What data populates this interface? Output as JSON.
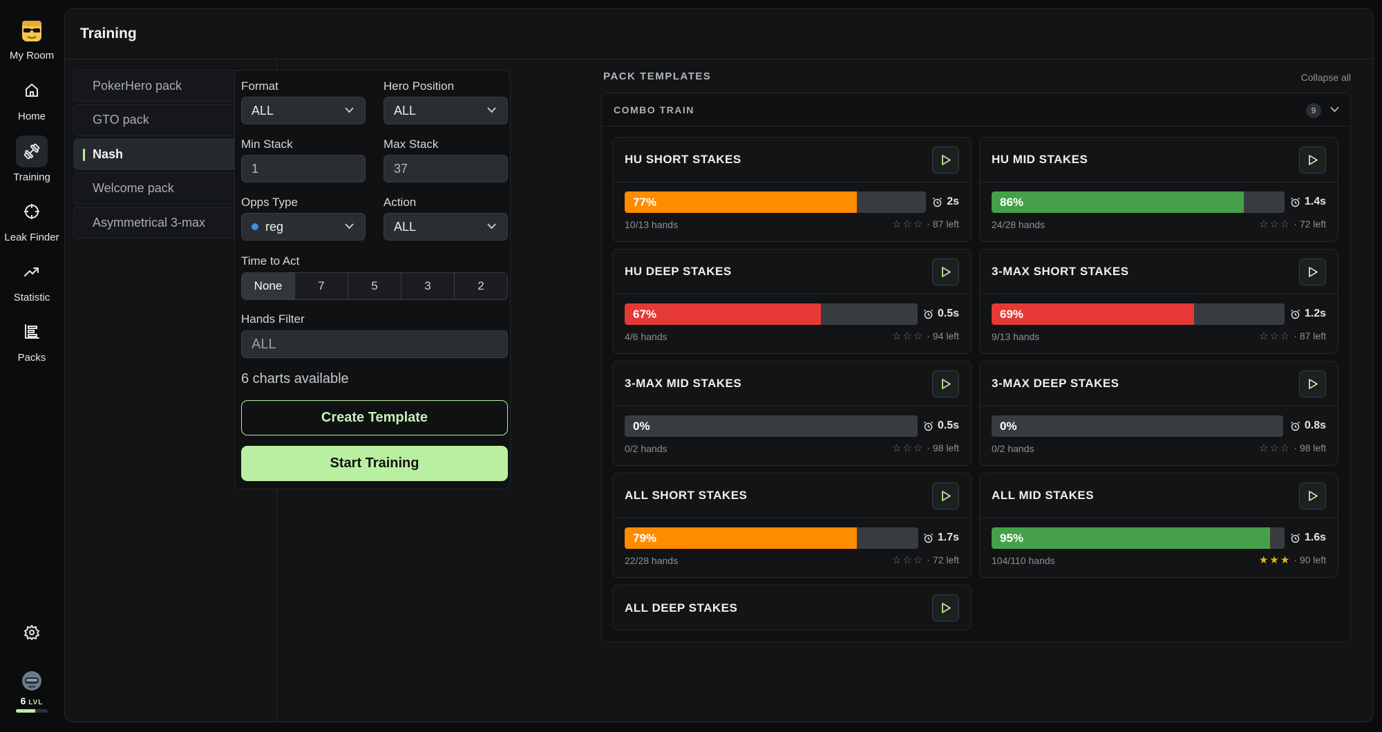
{
  "sidebar": {
    "items": [
      {
        "label": "My Room",
        "icon": "sunglasses-avatar-icon"
      },
      {
        "label": "Home",
        "icon": "home-icon"
      },
      {
        "label": "Training",
        "icon": "dumbbell-icon"
      },
      {
        "label": "Leak Finder",
        "icon": "crosshair-icon"
      },
      {
        "label": "Statistic",
        "icon": "trend-icon"
      },
      {
        "label": "Packs",
        "icon": "packs-icon"
      }
    ],
    "settings_icon": "gear-icon",
    "level": {
      "number": "6",
      "suffix": "LVL",
      "progress": 0.6
    }
  },
  "header": {
    "title": "Training"
  },
  "packs": [
    {
      "label": "PokerHero pack",
      "active": false
    },
    {
      "label": "GTO pack",
      "active": false
    },
    {
      "label": "Nash",
      "active": true
    },
    {
      "label": "Welcome pack",
      "active": false
    },
    {
      "label": "Asymmetrical 3-max",
      "active": false
    }
  ],
  "filters": {
    "format": {
      "label": "Format",
      "value": "ALL"
    },
    "hero_position": {
      "label": "Hero Position",
      "value": "ALL"
    },
    "min_stack": {
      "label": "Min Stack",
      "value": "1"
    },
    "max_stack": {
      "label": "Max Stack",
      "value": "37"
    },
    "opps_type": {
      "label": "Opps Type",
      "value": "reg"
    },
    "action": {
      "label": "Action",
      "value": "ALL"
    },
    "time_to_act": {
      "label": "Time to Act",
      "options": [
        "None",
        "7",
        "5",
        "3",
        "2"
      ],
      "selected": "None"
    },
    "hands_filter": {
      "label": "Hands Filter",
      "value": "ALL"
    },
    "charts_available": "6 charts available",
    "create_label": "Create Template",
    "start_label": "Start Training"
  },
  "templates": {
    "title": "PACK TEMPLATES",
    "collapse_label": "Collapse all",
    "group": {
      "title": "COMBO TRAIN",
      "count": "9"
    },
    "colors": {
      "orange": "#ff8c00",
      "green": "#45a049",
      "red": "#e53935"
    },
    "cards": [
      {
        "name": "HU SHORT STAKES",
        "percent": "77%",
        "progress": 0.77,
        "color": "#ff8c00",
        "time": "2s",
        "hands": "10/13 hands",
        "stars": 0,
        "left": "· 87 left"
      },
      {
        "name": "HU MID STAKES",
        "percent": "86%",
        "progress": 0.86,
        "color": "#45a049",
        "time": "1.4s",
        "hands": "24/28 hands",
        "stars": 0,
        "left": "· 72 left"
      },
      {
        "name": "HU DEEP STAKES",
        "percent": "67%",
        "progress": 0.67,
        "color": "#e53935",
        "time": "0.5s",
        "hands": "4/6 hands",
        "stars": 0,
        "left": "· 94 left"
      },
      {
        "name": "3-MAX SHORT STAKES",
        "percent": "69%",
        "progress": 0.69,
        "color": "#e53935",
        "time": "1.2s",
        "hands": "9/13 hands",
        "stars": 0,
        "left": "· 87 left"
      },
      {
        "name": "3-MAX MID STAKES",
        "percent": "0%",
        "progress": 0,
        "color": "#383c41",
        "time": "0.5s",
        "hands": "0/2 hands",
        "stars": 0,
        "left": "· 98 left"
      },
      {
        "name": "3-MAX DEEP STAKES",
        "percent": "0%",
        "progress": 0,
        "color": "#383c41",
        "time": "0.8s",
        "hands": "0/2 hands",
        "stars": 0,
        "left": "· 98 left"
      },
      {
        "name": "ALL SHORT STAKES",
        "percent": "79%",
        "progress": 0.79,
        "color": "#ff8c00",
        "time": "1.7s",
        "hands": "22/28 hands",
        "stars": 0,
        "left": "· 72 left"
      },
      {
        "name": "ALL MID STAKES",
        "percent": "95%",
        "progress": 0.95,
        "color": "#45a049",
        "time": "1.6s",
        "hands": "104/110 hands",
        "stars": 3,
        "left": "· 90 left"
      },
      {
        "name": "ALL DEEP STAKES"
      }
    ]
  }
}
